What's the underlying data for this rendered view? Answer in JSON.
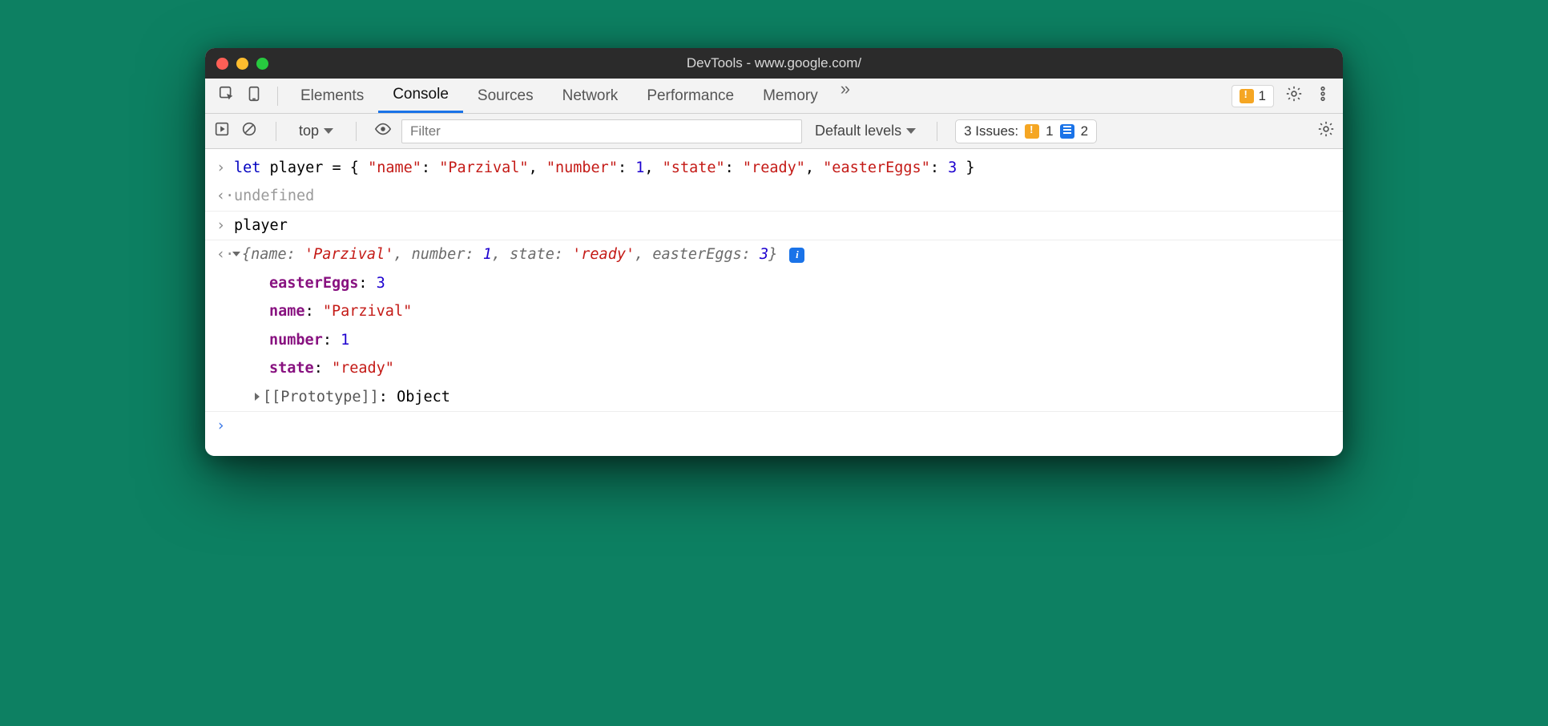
{
  "window": {
    "title": "DevTools - www.google.com/"
  },
  "tabs": {
    "items": [
      "Elements",
      "Console",
      "Sources",
      "Network",
      "Performance",
      "Memory"
    ],
    "active": "Console",
    "overflow_glyph": "»"
  },
  "tabbar_right": {
    "warning_count": "1"
  },
  "subbar": {
    "context": "top",
    "filter_placeholder": "Filter",
    "levels_label": "Default levels",
    "issues_label": "3 Issues:",
    "issues_warn": "1",
    "issues_info": "2"
  },
  "console": {
    "in1_parts": {
      "p0": "let",
      "p1": " player = { ",
      "p2": "\"name\"",
      "p3": ": ",
      "p4": "\"Parzival\"",
      "p5": ", ",
      "p6": "\"number\"",
      "p7": ": ",
      "p8": "1",
      "p9": ", ",
      "p10": "\"state\"",
      "p11": ": ",
      "p12": "\"ready\"",
      "p13": ", ",
      "p14": "\"easterEggs\"",
      "p15": ": ",
      "p16": "3",
      "p17": " }"
    },
    "out1": "undefined",
    "in2": "player",
    "summary": {
      "p0": "{name: ",
      "p1": "'Parzival'",
      "p2": ", number: ",
      "p3": "1",
      "p4": ", state: ",
      "p5": "'ready'",
      "p6": ", easterEggs: ",
      "p7": "3",
      "p8": "}"
    },
    "props": {
      "k0": "easterEggs",
      "v0": "3",
      "k1": "name",
      "v1": "\"Parzival\"",
      "k2": "number",
      "v2": "1",
      "k3": "state",
      "v3": "\"ready\""
    },
    "proto": {
      "label": "[[Prototype]]",
      "value": "Object"
    }
  }
}
